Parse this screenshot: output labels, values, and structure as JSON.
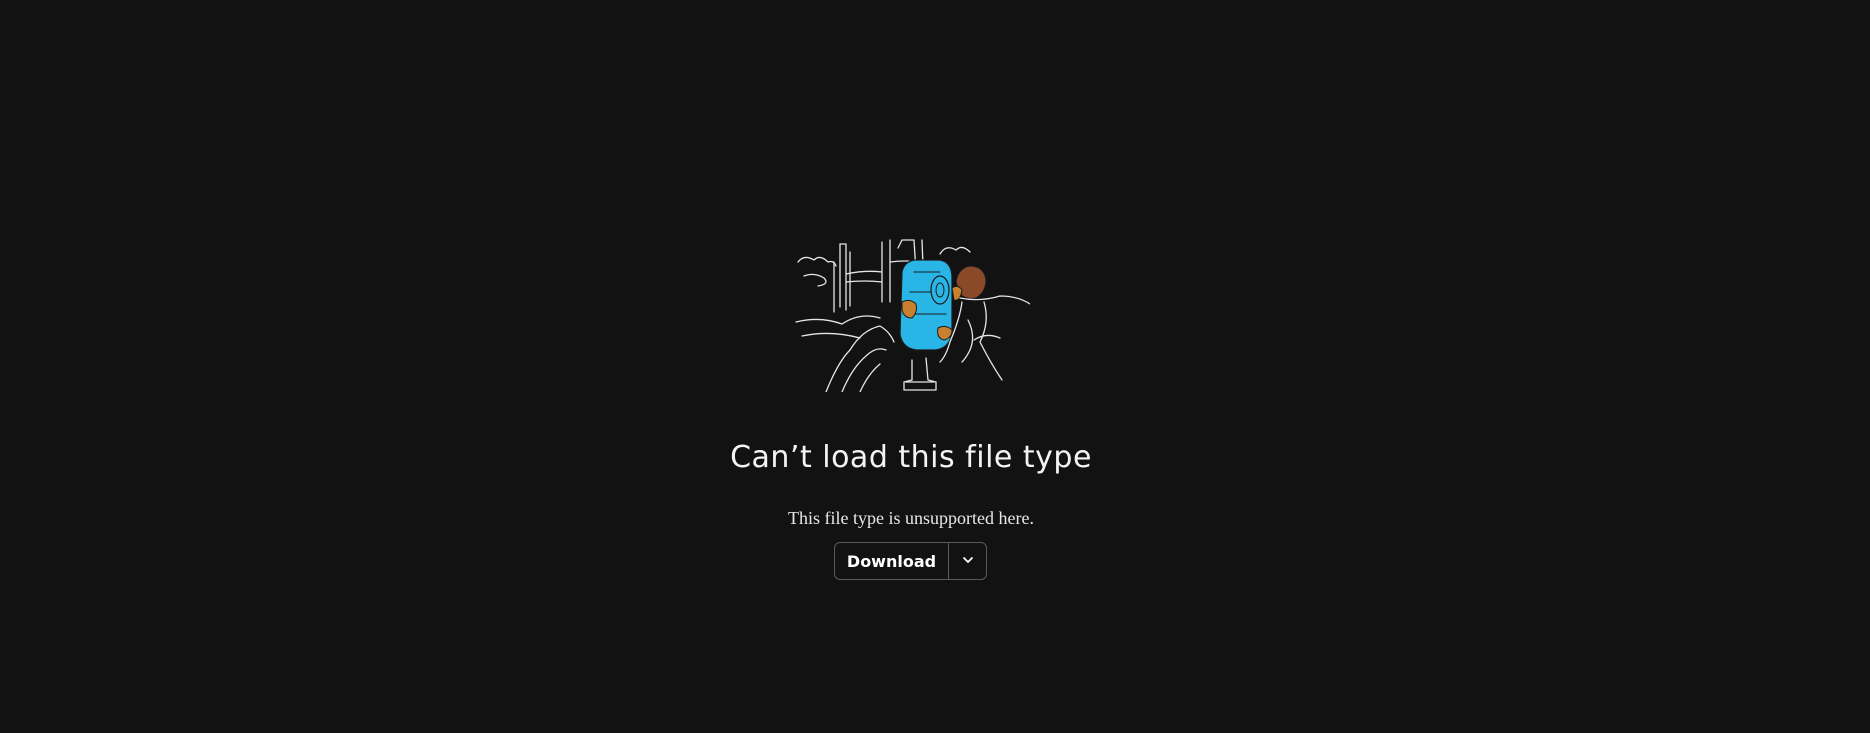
{
  "empty_state": {
    "illustration_icon": "person-looking-through-binoculars-illustration",
    "title": "Can’t load this file type",
    "message": "This file type is unsupported here."
  },
  "actions": {
    "download_label": "Download",
    "more_options_icon": "chevron-down-icon"
  },
  "colors": {
    "background": "#121212",
    "binocular_accent": "#29b6e6",
    "hair": "#8a4a2a",
    "border": "#5a5a5a"
  }
}
